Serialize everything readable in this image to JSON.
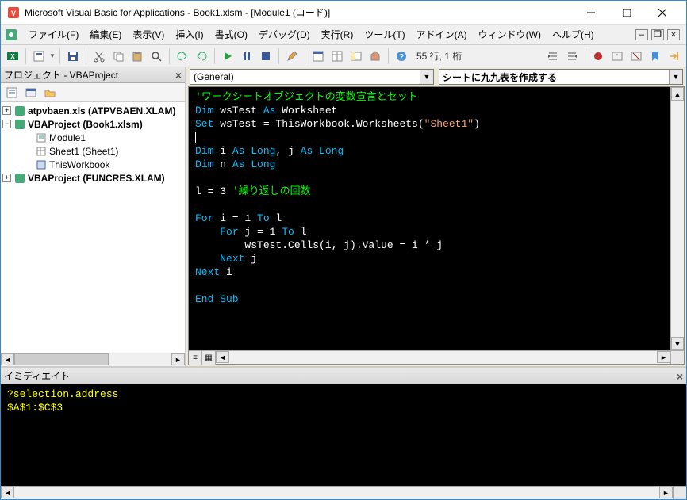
{
  "window": {
    "title": "Microsoft Visual Basic for Applications - Book1.xlsm - [Module1 (コード)]"
  },
  "menu": {
    "file": "ファイル(F)",
    "edit": "編集(E)",
    "view": "表示(V)",
    "insert": "挿入(I)",
    "format": "書式(O)",
    "debug": "デバッグ(D)",
    "run": "実行(R)",
    "tools": "ツール(T)",
    "addins": "アドイン(A)",
    "window": "ウィンドウ(W)",
    "help": "ヘルプ(H)"
  },
  "toolbar": {
    "status": "55 行, 1 桁"
  },
  "project": {
    "title": "プロジェクト - VBAProject",
    "items": {
      "atpvbaen": "atpvbaen.xls (ATPVBAEN.XLAM)",
      "book1": "VBAProject (Book1.xlsm)",
      "module1": "Module1",
      "sheet1": "Sheet1 (Sheet1)",
      "thisworkbook": "ThisWorkbook",
      "funcres": "VBAProject (FUNCRES.XLAM)"
    }
  },
  "code": {
    "object_dd": "(General)",
    "proc_dd": "シートに九九表を作成する",
    "comment1": "'ワークシートオブジェクトの変数宣言とセット",
    "dim_ws1": "Dim",
    "dim_ws2": " wsTest ",
    "dim_ws3": "As",
    "dim_ws4": " Worksheet",
    "set1": "Set",
    "set2": " wsTest = ThisWorkbook.Worksheets(",
    "set3": "\"Sheet1\"",
    "set4": ")",
    "dim_ij1": "Dim",
    "dim_ij2": " i ",
    "dim_ij3": "As Long",
    "dim_ij4": ", j ",
    "dim_ij5": "As Long",
    "dim_n1": "Dim",
    "dim_n2": " n ",
    "dim_n3": "As Long",
    "l_line1": "l = 3 ",
    "l_line2": "'繰り返しの回数",
    "for_i1": "For",
    "for_i2": " i = 1 ",
    "for_i3": "To",
    "for_i4": " l",
    "for_j1": "For",
    "for_j2": " j = 1 ",
    "for_j3": "To",
    "for_j4": " l",
    "cells": "        wsTest.Cells(i, j).Value = i * j",
    "next_j1": "Next",
    "next_j2": " j",
    "next_i1": "Next",
    "next_i2": " i",
    "endsub": "End Sub"
  },
  "immediate": {
    "title": "イミディエイト",
    "line1": "?selection.address",
    "line2": "$A$1:$C$3"
  }
}
